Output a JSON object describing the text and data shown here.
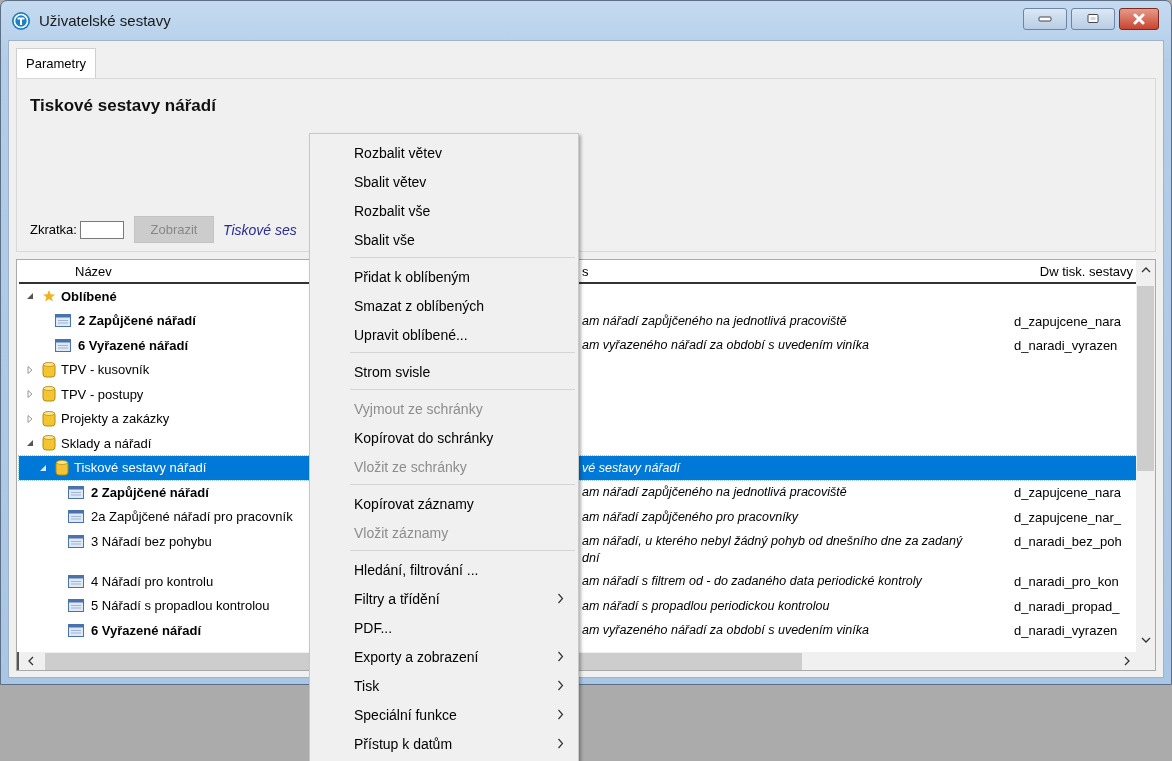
{
  "window": {
    "title": "Uživatelské sestavy"
  },
  "tabs": [
    {
      "label": "Parametry",
      "selected": true
    }
  ],
  "panel": {
    "heading": "Tiskové sestavy nářadí",
    "shortcut_label": "Zkratka:",
    "show_button": {
      "label": "Zobrazit",
      "disabled": true
    },
    "breadcrumb": "Tiskové ses"
  },
  "table": {
    "columns": [
      "Název",
      "s",
      "Dw tisk. sestavy"
    ],
    "rows": [
      {
        "label": "Oblíbené",
        "kind": "favorites",
        "bold": true,
        "expanded": true,
        "selected": false,
        "children": [
          {
            "label": "2 Zapůjčené nářadí",
            "kind": "report",
            "bold": true,
            "selected": false,
            "description": "am nářadí zapůjčeného na jednotlivá pracoviště",
            "dw": "d_zapujcene_nara"
          },
          {
            "label": "6 Vyřazené nářadí",
            "kind": "report",
            "bold": true,
            "selected": false,
            "description": "am vyřazeného nářadí za období s uvedením viníka",
            "dw": "d_naradi_vyrazen"
          }
        ]
      },
      {
        "label": "TPV - kusovník",
        "kind": "folder",
        "bold": false,
        "expanded": false,
        "selected": false
      },
      {
        "label": "TPV - postupy",
        "kind": "folder",
        "bold": false,
        "expanded": false,
        "selected": false
      },
      {
        "label": "Projekty a zakázky",
        "kind": "folder",
        "bold": false,
        "expanded": false,
        "selected": false
      },
      {
        "label": "Sklady a nářadí",
        "kind": "folder",
        "bold": false,
        "expanded": true,
        "selected": false,
        "children": [
          {
            "label": "Tiskové sestavy nářadí",
            "kind": "folder",
            "bold": false,
            "expanded": true,
            "selected": true,
            "description": "vé sestavy nářadí",
            "children": [
              {
                "label": "2 Zapůjčené nářadí",
                "kind": "report",
                "bold": true,
                "selected": false,
                "description": "am nářadí zapůjčeného na jednotlivá pracoviště",
                "dw": "d_zapujcene_nara"
              },
              {
                "label": "2a Zapůjčené nářadí pro pracovník",
                "kind": "report",
                "bold": false,
                "selected": false,
                "description": "am nářadí zapůjčeného pro pracovníky",
                "dw": "d_zapujcene_nar_"
              },
              {
                "label": "3 Nářadí bez pohybu",
                "kind": "report",
                "bold": false,
                "selected": false,
                "description": "am nářadí, u kterého nebyl žádný pohyb od dnešního dne za zadaný\ndní",
                "dw": "d_naradi_bez_poh"
              },
              {
                "label": "4 Nářadí pro kontrolu",
                "kind": "report",
                "bold": false,
                "selected": false,
                "description": "am nářadí s filtrem od - do zadaného data periodické kontroly",
                "dw": "d_naradi_pro_kon"
              },
              {
                "label": "5 Nářadí s propadlou kontrolou",
                "kind": "report",
                "bold": false,
                "selected": false,
                "description": "am nářadí s propadlou periodickou kontrolou",
                "dw": "d_naradi_propad_"
              },
              {
                "label": "6 Vyřazené nářadí",
                "kind": "report",
                "bold": true,
                "selected": false,
                "description": "am vyřazeného nářadí za období s uvedením viníka",
                "dw": "d_naradi_vyrazen"
              }
            ]
          }
        ]
      }
    ]
  },
  "context_menu": {
    "groups": [
      [
        {
          "label": "Rozbalit větev",
          "disabled": false,
          "submenu": false
        },
        {
          "label": "Sbalit větev",
          "disabled": false,
          "submenu": false
        },
        {
          "label": "Rozbalit vše",
          "disabled": false,
          "submenu": false
        },
        {
          "label": "Sbalit vše",
          "disabled": false,
          "submenu": false
        }
      ],
      [
        {
          "label": "Přidat k oblíbeným",
          "disabled": false,
          "submenu": false
        },
        {
          "label": "Smazat z oblíbených",
          "disabled": false,
          "submenu": false
        },
        {
          "label": "Upravit oblíbené...",
          "disabled": false,
          "submenu": false
        }
      ],
      [
        {
          "label": "Strom svisle",
          "disabled": false,
          "submenu": false
        }
      ],
      [
        {
          "label": "Vyjmout ze schránky",
          "disabled": true,
          "submenu": false
        },
        {
          "label": "Kopírovat do schránky",
          "disabled": false,
          "submenu": false
        },
        {
          "label": "Vložit ze schránky",
          "disabled": true,
          "submenu": false
        }
      ],
      [
        {
          "label": "Kopírovat záznamy",
          "disabled": false,
          "submenu": false
        },
        {
          "label": "Vložit záznamy",
          "disabled": true,
          "submenu": false
        }
      ],
      [
        {
          "label": "Hledání, filtrování ...",
          "disabled": false,
          "submenu": false
        },
        {
          "label": "Filtry a třídění",
          "disabled": false,
          "submenu": true
        },
        {
          "label": "PDF...",
          "disabled": false,
          "submenu": false
        },
        {
          "label": "Exporty a zobrazení",
          "disabled": false,
          "submenu": true
        },
        {
          "label": "Tisk",
          "disabled": false,
          "submenu": true
        },
        {
          "label": "Speciální funkce",
          "disabled": false,
          "submenu": true
        },
        {
          "label": "Přístup k datům",
          "disabled": false,
          "submenu": true
        }
      ]
    ]
  }
}
